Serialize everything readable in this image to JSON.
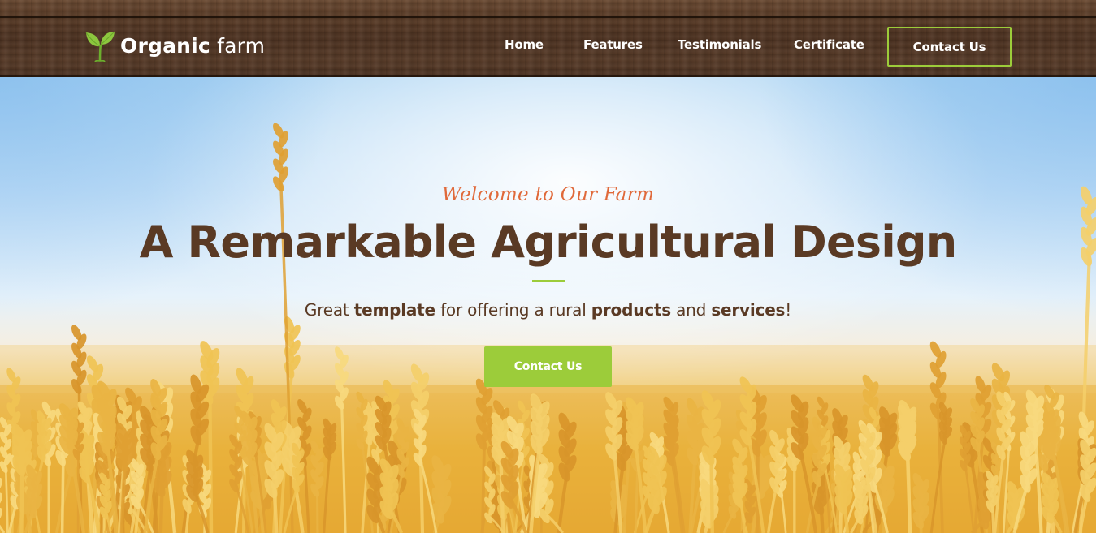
{
  "header": {
    "logo": {
      "icon": "sprout-icon",
      "brand_bold": "Organic",
      "brand_light": "farm"
    },
    "nav": {
      "home": "Home",
      "features": "Features",
      "testimonials": "Testimonials",
      "certificate": "Certificate",
      "contact": "Contact Us"
    }
  },
  "hero": {
    "welcome": "Welcome to Our Farm",
    "headline": "A Remarkable Agricultural Design",
    "tagline": {
      "part1": "Great ",
      "bold1": "template",
      "part2": " for offering a rural ",
      "bold2": "products",
      "part3": " and ",
      "bold3": "services",
      "part4": "!"
    },
    "cta": "Contact Us"
  },
  "colors": {
    "accent_green": "#9ccc3a",
    "heading_brown": "#5a3a24",
    "script_orange": "#e0693a",
    "wood_brown": "#4e3322"
  }
}
